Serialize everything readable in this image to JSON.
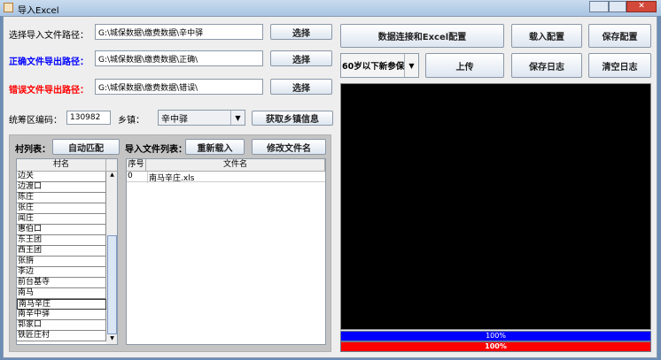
{
  "window": {
    "title": "导入Excel"
  },
  "paths": [
    {
      "label": "选择导入文件路径：",
      "value": "G:\\城保数据\\缴费数据\\辛中驿",
      "button": "选择",
      "color": "#000000"
    },
    {
      "label": "正确文件导出路径：",
      "value": "G:\\城保数据\\缴费数据\\正确\\",
      "button": "选择",
      "color": "#0000ff"
    },
    {
      "label": "错误文件导出路径：",
      "value": "G:\\城保数据\\缴费数据\\错误\\",
      "button": "选择",
      "color": "#ff0000"
    }
  ],
  "region": {
    "code_label": "统筹区编码：",
    "code_value": "130982",
    "town_label": "乡镇：",
    "town_value": "辛中驿",
    "fetch_button": "获取乡镇信息"
  },
  "panel": {
    "village_label": "村列表：",
    "auto_match": "自动匹配",
    "file_list_label": "导入文件列表：",
    "reload": "重新载入",
    "rename": "修改文件名",
    "village_header": "村名",
    "villages": [
      "边关",
      "边渡口",
      "陈庄",
      "张庄",
      "闻庄",
      "惠伯口",
      "东王团",
      "西王团",
      "张旃",
      "李边",
      "前台基寺",
      "南马",
      "南马辛庄",
      "南辛中驿",
      "郭家口",
      "铁匠庄村"
    ],
    "selected_village": "南马辛庄",
    "file_headers": [
      "序号",
      "文件名"
    ],
    "files": [
      {
        "index": "0",
        "name": "南马辛庄.xls"
      }
    ]
  },
  "right": {
    "db_config": "数据连接和Excel配置",
    "load_config": "载入配置",
    "save_config": "保存配置",
    "mode": "60岁以下新参保",
    "upload": "上传",
    "save_log": "保存日志",
    "clear_log": "清空日志",
    "progress": [
      {
        "label": "100%",
        "value": 100,
        "color": "#0000ff"
      },
      {
        "label": "100%",
        "value": 100,
        "color": "#ff0000"
      }
    ]
  }
}
